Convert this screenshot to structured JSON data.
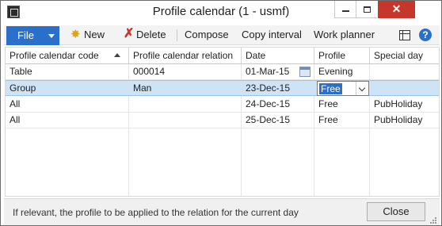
{
  "window": {
    "title": "Profile calendar (1 - usmf)"
  },
  "title_buttons": {
    "close_glyph": "✕"
  },
  "toolbar": {
    "file_label": "File",
    "new_label": "New",
    "delete_label": "Delete",
    "compose_label": "Compose",
    "copy_interval_label": "Copy interval",
    "work_planner_label": "Work planner",
    "help_glyph": "?"
  },
  "grid": {
    "columns": [
      "Profile calendar code",
      "Profile calendar relation",
      "Date",
      "Profile",
      "Special day"
    ],
    "rows": [
      {
        "code": "Table",
        "relation": "000014",
        "date": "01-Mar-15",
        "profile": "Evening",
        "special_day": ""
      },
      {
        "code": "Group",
        "relation": "Man",
        "date": "23-Dec-15",
        "profile": "Free",
        "special_day": ""
      },
      {
        "code": "All",
        "relation": "",
        "date": "24-Dec-15",
        "profile": "Free",
        "special_day": "PubHoliday"
      },
      {
        "code": "All",
        "relation": "",
        "date": "25-Dec-15",
        "profile": "Free",
        "special_day": "PubHoliday"
      }
    ],
    "selected_row_index": 1
  },
  "status": {
    "help_text": "If relevant, the profile to be applied to the relation for the current day",
    "close_label": "Close"
  },
  "colors": {
    "accent": "#2a6fc9",
    "selected_row": "#cfe3f7",
    "close_button_red": "#c7362b"
  },
  "icons": {
    "app": "app-icon",
    "new": "sun-new-icon",
    "delete": "red-x-delete-icon",
    "layout": "layout-grid-icon",
    "help": "help-icon",
    "calendar": "calendar-icon",
    "dropdown": "chevron-down-icon"
  }
}
